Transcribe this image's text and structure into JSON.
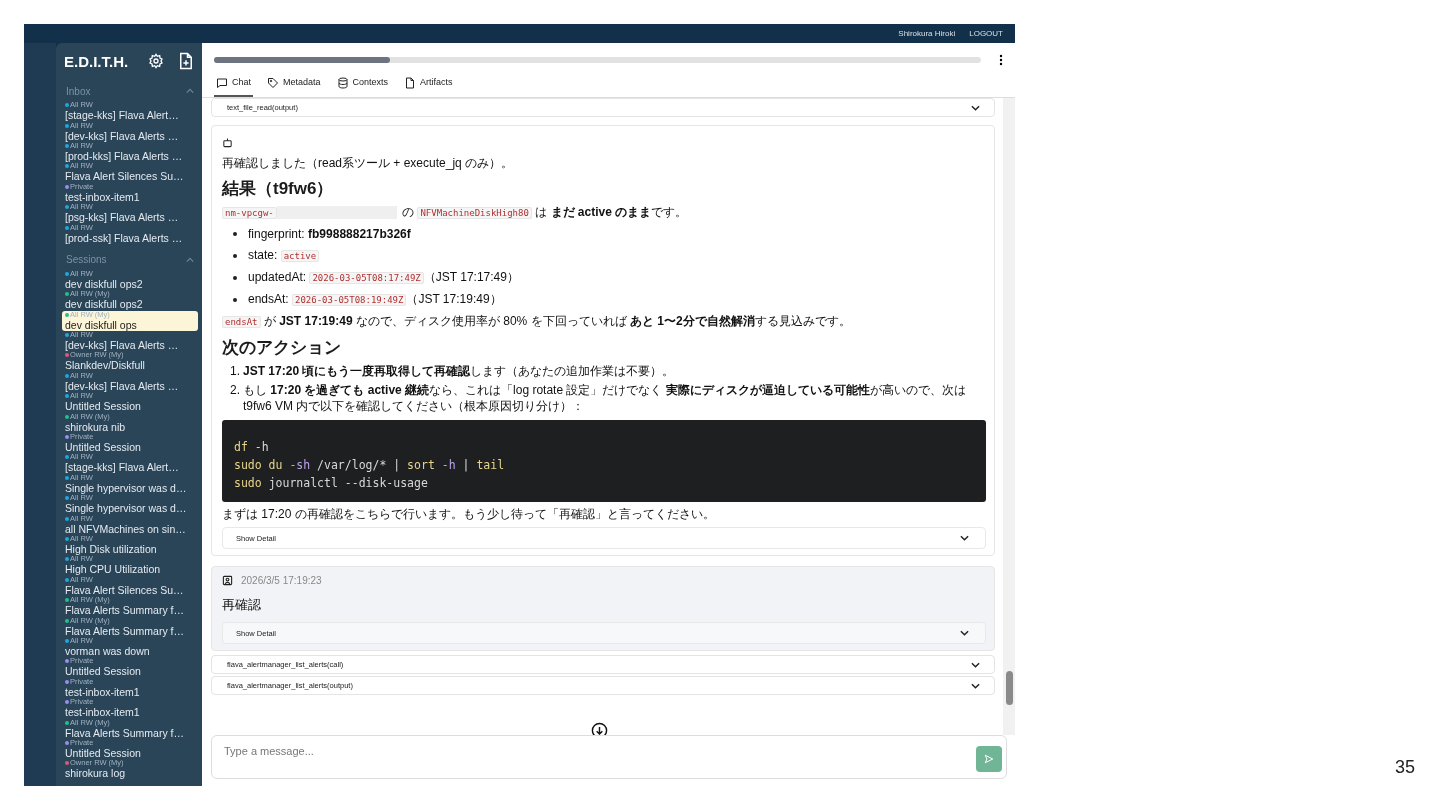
{
  "top_bar": {
    "user": "Shirokura Hiroki",
    "logout": "LOGOUT"
  },
  "sidebar": {
    "title": "E.D.I.T.H.",
    "sections": [
      {
        "label": "Inbox",
        "expanded": true,
        "items": [
          {
            "tag": "All RW",
            "title": "[stage-kks] Flava Alert…",
            "color": "#1ea7e0",
            "selected": false
          },
          {
            "tag": "All RW",
            "title": "[dev-kks] Flava Alerts …",
            "color": "#1ea7e0",
            "selected": false
          },
          {
            "tag": "All RW",
            "title": "[prod-kks] Flava Alerts …",
            "color": "#1ea7e0",
            "selected": false
          },
          {
            "tag": "All RW",
            "title": "Flava Alert Silences Su…",
            "color": "#1ea7e0",
            "selected": false
          },
          {
            "tag": "Private",
            "title": "test-inbox-item1",
            "color": "#9b8cf0",
            "selected": false
          },
          {
            "tag": "All RW",
            "title": "[psg-kks] Flava Alerts …",
            "color": "#1ea7e0",
            "selected": false
          },
          {
            "tag": "All RW",
            "title": "[prod-ssk] Flava Alerts …",
            "color": "#1ea7e0",
            "selected": false
          }
        ]
      },
      {
        "label": "Sessions",
        "expanded": true,
        "items": [
          {
            "tag": "All RW",
            "title": "dev diskfull ops2",
            "color": "#1ea7e0",
            "selected": false
          },
          {
            "tag": "All RW (My)",
            "title": "dev diskfull ops2",
            "color": "#22c08a",
            "selected": false
          },
          {
            "tag": "All RW (My)",
            "title": "dev diskfull ops",
            "color": "#22c08a",
            "selected": true
          },
          {
            "tag": "All RW",
            "title": "[dev-kks] Flava Alerts …",
            "color": "#1ea7e0",
            "selected": false
          },
          {
            "tag": "Owner RW (My)",
            "title": "Slankdev/Diskfull",
            "color": "#e0557a",
            "selected": false
          },
          {
            "tag": "All RW",
            "title": "[dev-kks] Flava Alerts …",
            "color": "#1ea7e0",
            "selected": false
          },
          {
            "tag": "All RW",
            "title": "Untitled Session",
            "color": "#1ea7e0",
            "selected": false
          },
          {
            "tag": "All RW (My)",
            "title": "shirokura nib",
            "color": "#22c08a",
            "selected": false
          },
          {
            "tag": "Private",
            "title": "Untitled Session",
            "color": "#9b8cf0",
            "selected": false
          },
          {
            "tag": "All RW",
            "title": "[stage-kks] Flava Alert…",
            "color": "#1ea7e0",
            "selected": false
          },
          {
            "tag": "All RW",
            "title": "Single hypervisor was d…",
            "color": "#1ea7e0",
            "selected": false
          },
          {
            "tag": "All RW",
            "title": "Single hypervisor was d…",
            "color": "#1ea7e0",
            "selected": false
          },
          {
            "tag": "All RW",
            "title": "all NFVMachines on sin…",
            "color": "#1ea7e0",
            "selected": false
          },
          {
            "tag": "All RW",
            "title": "High Disk utilization",
            "color": "#1ea7e0",
            "selected": false
          },
          {
            "tag": "All RW",
            "title": "High CPU Utilization",
            "color": "#1ea7e0",
            "selected": false
          },
          {
            "tag": "All RW",
            "title": "Flava Alert Silences Su…",
            "color": "#1ea7e0",
            "selected": false
          },
          {
            "tag": "All RW (My)",
            "title": "Flava Alerts Summary f…",
            "color": "#22c08a",
            "selected": false
          },
          {
            "tag": "All RW (My)",
            "title": "Flava Alerts Summary f…",
            "color": "#22c08a",
            "selected": false
          },
          {
            "tag": "All RW",
            "title": "vorman was down",
            "color": "#1ea7e0",
            "selected": false
          },
          {
            "tag": "Private",
            "title": "Untitled Session",
            "color": "#9b8cf0",
            "selected": false
          },
          {
            "tag": "Private",
            "title": "test-inbox-item1",
            "color": "#9b8cf0",
            "selected": false
          },
          {
            "tag": "Private",
            "title": "test-inbox-item1",
            "color": "#9b8cf0",
            "selected": false
          },
          {
            "tag": "All RW (My)",
            "title": "Flava Alerts Summary f…",
            "color": "#22c08a",
            "selected": false
          },
          {
            "tag": "Private",
            "title": "Untitled Session",
            "color": "#9b8cf0",
            "selected": false
          },
          {
            "tag": "Owner RW (My)",
            "title": "shirokura log",
            "color": "#e0557a",
            "selected": false
          }
        ]
      }
    ]
  },
  "header": {
    "progress": {
      "level": 0.23
    },
    "tabs": [
      {
        "label": "Chat",
        "selected": true
      },
      {
        "label": "Metadata",
        "selected": false
      },
      {
        "label": "Contexts",
        "selected": false
      },
      {
        "label": "Artifacts",
        "selected": false
      }
    ]
  },
  "messages": [
    {
      "kind": "tool",
      "label": "text_file_read(output)"
    },
    {
      "kind": "assistant",
      "detail": "Show Detail",
      "blocks": [
        {
          "kind": "p",
          "segs": [
            {
              "kind": "text",
              "text": "再確認しました（read系ツール + execute_jq のみ）。"
            }
          ]
        },
        {
          "kind": "h2",
          "text": "結果（t9fw6）"
        },
        {
          "kind": "p",
          "segs": [
            {
              "kind": "code",
              "text": "nm-vpcgw-"
            },
            {
              "kind": "redacted"
            },
            {
              "kind": "text",
              "text": " の "
            },
            {
              "kind": "code",
              "text": "NFVMachineDiskHigh80"
            },
            {
              "kind": "text",
              "text": " は **まだ active のまま**です。"
            }
          ]
        },
        {
          "kind": "ul",
          "items": [
            {
              "segs": [
                {
                  "kind": "text",
                  "text": "fingerprint: **fb998888217b326f**"
                }
              ]
            },
            {
              "segs": [
                {
                  "kind": "text",
                  "text": "state: "
                },
                {
                  "kind": "code",
                  "text": "active"
                }
              ]
            },
            {
              "segs": [
                {
                  "kind": "text",
                  "text": "updatedAt: "
                },
                {
                  "kind": "code",
                  "text": "2026-03-05T08:17:49Z"
                },
                {
                  "kind": "text",
                  "text": "（JST 17:17:49）"
                }
              ]
            },
            {
              "segs": [
                {
                  "kind": "text",
                  "text": "endsAt: "
                },
                {
                  "kind": "code",
                  "text": "2026-03-05T08:19:49Z"
                },
                {
                  "kind": "text",
                  "text": "（JST 17:19:49）"
                }
              ]
            }
          ]
        },
        {
          "kind": "p",
          "segs": [
            {
              "kind": "code",
              "text": "endsAt"
            },
            {
              "kind": "text",
              "text": " が **JST 17:19:49** なので、ディスク使用率が 80% を下回っていれば **あと 1〜2分で自然解消**する見込みです。"
            }
          ]
        },
        {
          "kind": "h2",
          "text": "次のアクション"
        },
        {
          "kind": "ol",
          "items": [
            {
              "number": "1.",
              "segs": [
                {
                  "kind": "text",
                  "text": "**JST 17:20 頃にもう一度再取得して再確認**します（あなたの追加作業は不要）。"
                }
              ]
            },
            {
              "number": "2.",
              "segs": [
                {
                  "kind": "text",
                  "text": "もし **17:20 を過ぎても active 継続**なら、これは「log rotate 設定」だけでなく **実際にディスクが逼迫している可能性**が高いので、次は t9fw6 VM 内で以下を確認してください（根本原因切り分け）："
                }
              ]
            }
          ]
        },
        {
          "kind": "code",
          "lines": [
            [
              {
                "kind": "cmd",
                "text": "df"
              },
              {
                "kind": "plain",
                "text": " -h"
              }
            ],
            [
              {
                "kind": "cmd",
                "text": "sudo du"
              },
              {
                "kind": "flag",
                "text": " -sh"
              },
              {
                "kind": "plain",
                "text": " /var/log/* | "
              },
              {
                "kind": "cmd",
                "text": "sort"
              },
              {
                "kind": "flag",
                "text": " -h"
              },
              {
                "kind": "plain",
                "text": " | "
              },
              {
                "kind": "cmd",
                "text": "tail"
              }
            ],
            [
              {
                "kind": "cmd",
                "text": "sudo"
              },
              {
                "kind": "plain",
                "text": " journalctl --disk-usage"
              }
            ]
          ]
        },
        {
          "kind": "p",
          "segs": [
            {
              "kind": "text",
              "text": "まずは 17:20 の再確認をこちらで行います。もう少し待って「再確認」と言ってください。"
            }
          ]
        }
      ]
    },
    {
      "kind": "user",
      "time": "2026/3/5 17:19:23",
      "text": "再確認",
      "detail": "Show Detail"
    },
    {
      "kind": "tool",
      "label": "flava_alertmanager_list_alerts(call)"
    },
    {
      "kind": "tool",
      "label": "flava_alertmanager_list_alerts(output)"
    }
  ],
  "composer": {
    "placeholder": "Type a message..."
  },
  "page_number": "35"
}
